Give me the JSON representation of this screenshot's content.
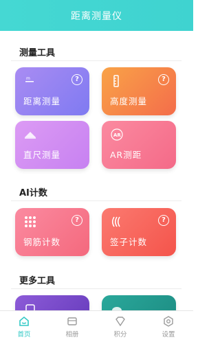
{
  "app": {
    "title": "距离测量仪"
  },
  "sections": {
    "measure_tools": "测量工具",
    "ai_count": "AI计数",
    "more_tools": "更多工具"
  },
  "cards": {
    "distance": {
      "label": "距离测量",
      "icon": "distance-icon"
    },
    "height": {
      "label": "高度测量",
      "icon": "height-ruler-icon"
    },
    "ruler": {
      "label": "直尺测量",
      "icon": "ruler-icon"
    },
    "ar": {
      "label": "AR测距",
      "icon": "ar-icon"
    },
    "rebar": {
      "label": "钢筋计数",
      "icon": "rebar-icon"
    },
    "sticks": {
      "label": "签子计数",
      "icon": "sticks-icon"
    }
  },
  "help_glyph": "?",
  "tabs": [
    {
      "label": "首页",
      "icon": "home-icon"
    },
    {
      "label": "相册",
      "icon": "album-icon"
    },
    {
      "label": "积分",
      "icon": "points-icon"
    },
    {
      "label": "设置",
      "icon": "settings-icon"
    }
  ],
  "colors": {
    "accent": "#33c9c6",
    "titlebar": "#45d8d3"
  }
}
